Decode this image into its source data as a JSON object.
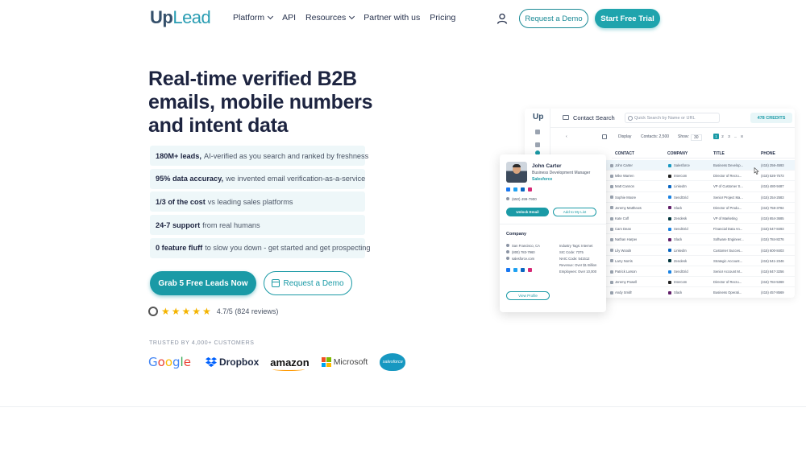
{
  "brand": {
    "logo_up": "Up",
    "logo_lead": "Lead"
  },
  "nav": {
    "items": [
      {
        "label": "Platform",
        "dropdown": true
      },
      {
        "label": "API",
        "dropdown": false
      },
      {
        "label": "Resources",
        "dropdown": true
      },
      {
        "label": "Partner with us",
        "dropdown": false
      },
      {
        "label": "Pricing",
        "dropdown": false
      }
    ],
    "account_icon": "user-icon",
    "demo_button": "Request a Demo",
    "trial_button": "Start Free Trial"
  },
  "hero": {
    "title": "Real-time verified B2B emails, mobile numbers and intent data",
    "features": [
      {
        "bold": "180M+ leads,",
        "text": "AI-verified as you search and ranked by freshness"
      },
      {
        "bold": "95% data accuracy,",
        "text": "we invented email verification-as-a-service"
      },
      {
        "bold": "1/3 of the cost",
        "text": "vs leading sales platforms"
      },
      {
        "bold": "24-7 support",
        "text": "from real humans"
      },
      {
        "bold": "0 feature fluff",
        "text": "to slow you down - get started and get prospecting"
      }
    ],
    "cta_primary": "Grab 5 Free Leads Now",
    "cta_secondary": "Request a Demo",
    "rating_text": "4.7/5 (824 reviews)",
    "rating_value": 4.7,
    "rating_max": 5
  },
  "trusted": {
    "label": "TRUSTED BY 4,000+ CUSTOMERS",
    "logos": {
      "google": [
        "G",
        "o",
        "o",
        "g",
        "l",
        "e"
      ],
      "dropbox": "Dropbox",
      "amazon": "amazon",
      "microsoft": "Microsoft",
      "salesforce": "salesforce"
    }
  },
  "app": {
    "logo": "Up",
    "title": "Contact Search",
    "search_placeholder": "Quick Search by Name or URL",
    "credits": "478 CREDITS",
    "toolbar": {
      "display": "Display",
      "contacts": "Contacts: 2,500",
      "show": "Show:",
      "show_value": "30",
      "pages": [
        "1",
        "2",
        "3",
        "...",
        "8"
      ]
    },
    "columns": [
      "CONTACT",
      "COMPANY",
      "TITLE",
      "PHONE"
    ],
    "rows": [
      {
        "contact": "John Carter",
        "company": "Salesforce",
        "title": "Business Develop...",
        "phone": "(415) 256-4593",
        "color": "#1798c1"
      },
      {
        "contact": "Mike Warren",
        "company": "Intercom",
        "title": "Director of Recru...",
        "phone": "(415) 526-7573",
        "color": "#222222"
      },
      {
        "contact": "Matt Cannon",
        "company": "LinkedIn",
        "title": "VP of Customer S...",
        "phone": "(415) 480-9487",
        "color": "#0a66c2"
      },
      {
        "contact": "Sophie Moore",
        "company": "SendGrid",
        "title": "Senior Project Ma...",
        "phone": "(415) 254-2583",
        "color": "#1a82e2"
      },
      {
        "contact": "Jeremy Matthews",
        "company": "Slack",
        "title": "Director of Produ...",
        "phone": "(415) 758-3784",
        "color": "#611f69"
      },
      {
        "contact": "Kate Coff",
        "company": "Zendesk",
        "title": "VP of Marketing",
        "phone": "(415) 654-3685",
        "color": "#03363d"
      },
      {
        "contact": "Cam Dean",
        "company": "SendGrid",
        "title": "Financial Data An...",
        "phone": "(415) 547-8493",
        "color": "#1a82e2"
      },
      {
        "contact": "Nathan Harper",
        "company": "Slack",
        "title": "Software Engineer...",
        "phone": "(415) 784-8276",
        "color": "#611f69"
      },
      {
        "contact": "Lily Woods",
        "company": "LinkedIn",
        "title": "Customer Succes...",
        "phone": "(415) 600-8403",
        "color": "#0a66c2"
      },
      {
        "contact": "Larry Norris",
        "company": "Zendesk",
        "title": "Strategic Account...",
        "phone": "(415) 541-2346",
        "color": "#03363d"
      },
      {
        "contact": "Patrick Larson",
        "company": "SendGrid",
        "title": "Senior Account M...",
        "phone": "(415) 847-3256",
        "color": "#1a82e2"
      },
      {
        "contact": "Jeremy Powell",
        "company": "Intercom",
        "title": "Director of Recru...",
        "phone": "(415) 784-5369",
        "color": "#222222"
      },
      {
        "contact": "Andy Smith",
        "company": "Slack",
        "title": "Business Operati...",
        "phone": "(415) 457-8569",
        "color": "#611f69"
      }
    ]
  },
  "card": {
    "name": "John Carter",
    "title": "Business Development Manager",
    "company": "Salesforce",
    "phone": "(650) 499-7900",
    "unlock": "Unlock Email",
    "add_list": "Add to My List",
    "section": "Company",
    "left": [
      "San Francisco, CA",
      "(800) 783-7960",
      "salesforce.com"
    ],
    "right": [
      "Industry Tags: Internet",
      "SIC Code: 7375",
      "NAIC Code: 541512",
      "Revenue: Over $1 Billion",
      "Employees: Over 10,000"
    ],
    "view_profile": "View Profile"
  }
}
